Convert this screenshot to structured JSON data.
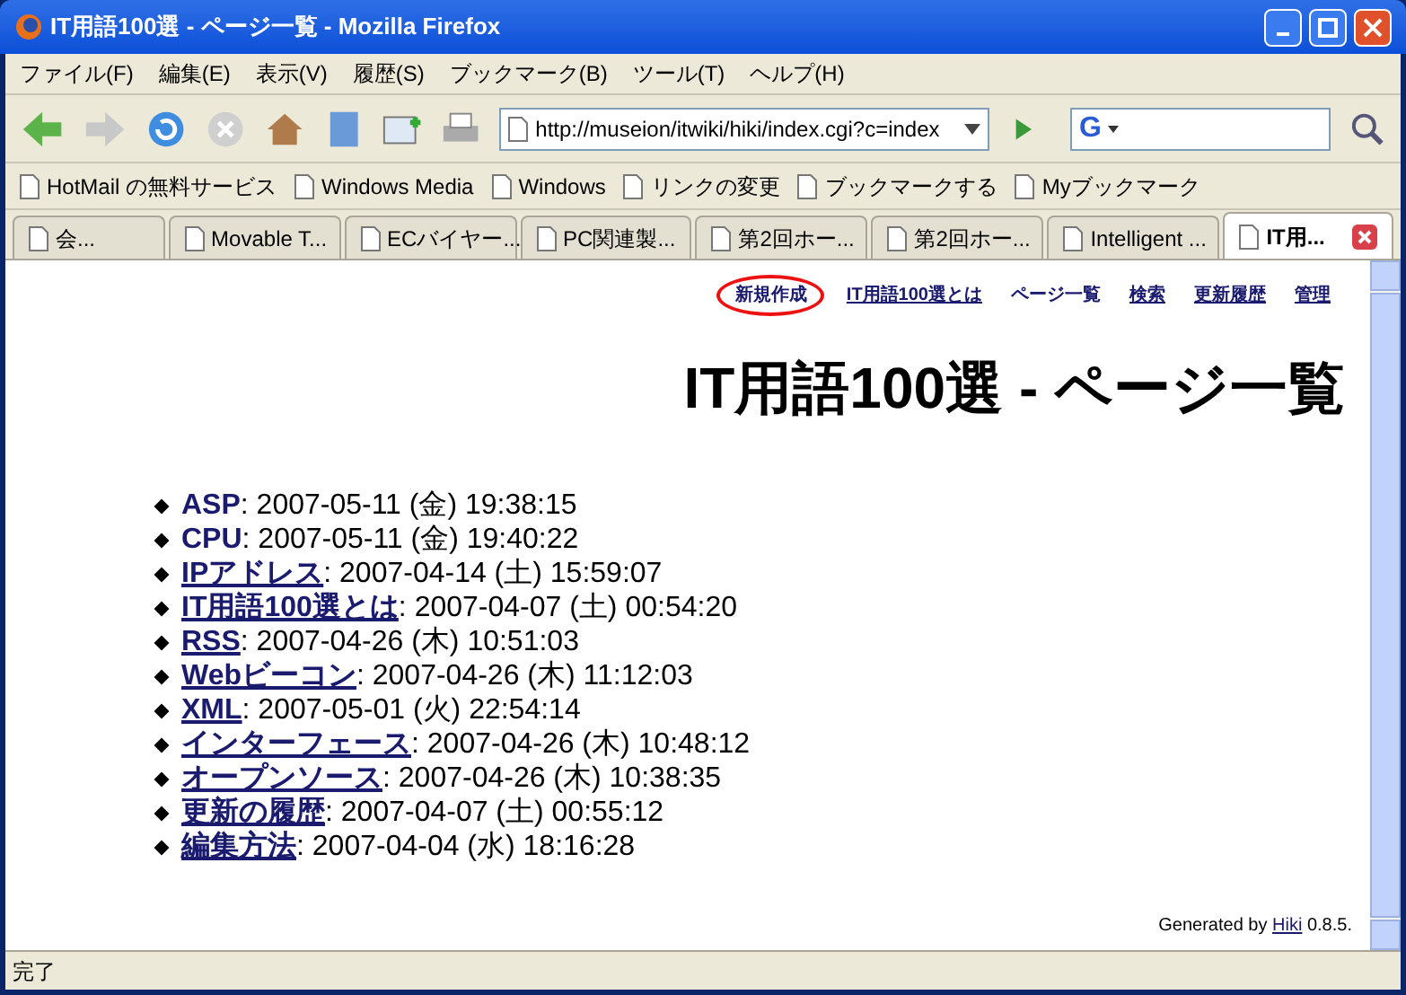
{
  "window": {
    "title": "IT用語100選 - ページ一覧 - Mozilla Firefox"
  },
  "menu": [
    "ファイル(F)",
    "編集(E)",
    "表示(V)",
    "履歴(S)",
    "ブックマーク(B)",
    "ツール(T)",
    "ヘルプ(H)"
  ],
  "address": {
    "value": "http://museion/itwiki/hiki/index.cgi?c=index"
  },
  "search": {
    "engine_logo": "G"
  },
  "bookmarks": [
    "HotMail の無料サービス",
    "Windows Media",
    "Windows",
    "リンクの変更",
    "ブックマークする",
    "Myブックマーク"
  ],
  "tabs": [
    {
      "label": "会...",
      "selected": false
    },
    {
      "label": "Movable T...",
      "selected": false
    },
    {
      "label": "ECバイヤー...",
      "selected": false
    },
    {
      "label": "PC関連製...",
      "selected": false
    },
    {
      "label": "第2回ホー...",
      "selected": false
    },
    {
      "label": "第2回ホー...",
      "selected": false
    },
    {
      "label": "Intelligent ...",
      "selected": false
    },
    {
      "label": "IT用...",
      "selected": true
    }
  ],
  "nav": [
    {
      "label": "新規作成",
      "underlined": false,
      "circled": true
    },
    {
      "label": "IT用語100選とは",
      "underlined": true,
      "circled": false
    },
    {
      "label": "ページ一覧",
      "underlined": false,
      "circled": false
    },
    {
      "label": "検索",
      "underlined": true,
      "circled": false
    },
    {
      "label": "更新履歴",
      "underlined": true,
      "circled": false
    },
    {
      "label": "管理",
      "underlined": true,
      "circled": false
    }
  ],
  "heading": "IT用語100選 - ページ一覧",
  "pages": [
    {
      "name": "ASP",
      "date": ": 2007-05-11 (金) 19:38:15",
      "underlined": false
    },
    {
      "name": "CPU",
      "date": ": 2007-05-11 (金) 19:40:22",
      "underlined": false
    },
    {
      "name": "IPアドレス",
      "date": ": 2007-04-14 (土) 15:59:07",
      "underlined": true
    },
    {
      "name": "IT用語100選とは",
      "date": ": 2007-04-07 (土) 00:54:20",
      "underlined": true
    },
    {
      "name": "RSS",
      "date": ": 2007-04-26 (木) 10:51:03",
      "underlined": true
    },
    {
      "name": "Webビーコン",
      "date": ": 2007-04-26 (木) 11:12:03",
      "underlined": true
    },
    {
      "name": "XML",
      "date": ": 2007-05-01 (火) 22:54:14",
      "underlined": true
    },
    {
      "name": "インターフェース",
      "date": ": 2007-04-26 (木) 10:48:12",
      "underlined": true
    },
    {
      "name": "オープンソース",
      "date": ": 2007-04-26 (木) 10:38:35",
      "underlined": true
    },
    {
      "name": "更新の履歴",
      "date": ": 2007-04-07 (土) 00:55:12",
      "underlined": true
    },
    {
      "name": "編集方法",
      "date": ": 2007-04-04 (水) 18:16:28",
      "underlined": true
    }
  ],
  "footer": {
    "before": "Generated by",
    "link": "Hiki",
    "after": "0.8.5."
  },
  "status_bar": {
    "text": "完了"
  }
}
